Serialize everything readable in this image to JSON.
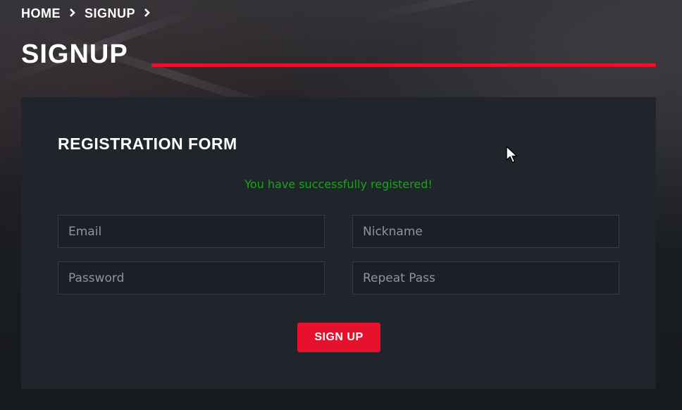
{
  "breadcrumb": {
    "items": [
      {
        "label": "HOME"
      },
      {
        "label": "SIGNUP"
      }
    ],
    "separator_icon": "chevron-right-icon"
  },
  "page": {
    "title": "SIGNUP"
  },
  "form": {
    "title": "REGISTRATION FORM",
    "success_message": "You have successfully registered!",
    "fields": {
      "email": {
        "placeholder": "Email",
        "value": ""
      },
      "nickname": {
        "placeholder": "Nickname",
        "value": ""
      },
      "password": {
        "placeholder": "Password",
        "value": ""
      },
      "repeat_pass": {
        "placeholder": "Repeat Pass",
        "value": ""
      }
    },
    "submit_label": "SIGN UP"
  },
  "colors": {
    "accent": "#e8112d",
    "success": "#1ba31b",
    "panel": "#20252b"
  },
  "cursor_icon": "mouse-pointer-icon"
}
